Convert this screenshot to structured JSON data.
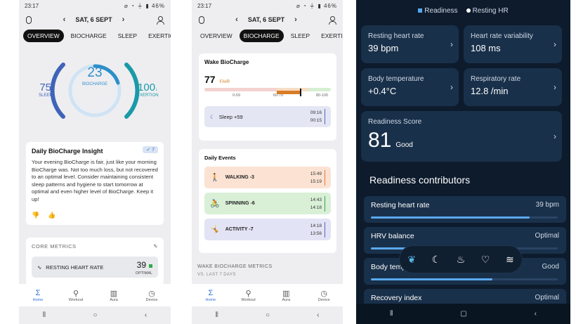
{
  "phone1": {
    "status": {
      "time": "23:17",
      "left_icons": "▣ ◎ ✉ •",
      "right": "⌀ ◔ ⏚ ▮ 46%"
    },
    "date": "SAT, 6 SEPT",
    "tabs": [
      "OVERVIEW",
      "BIOCHARGE",
      "SLEEP",
      "EXERTION"
    ],
    "gauge": {
      "center_value": "23",
      "center_label": "BIOCHARGE",
      "left_value": "75",
      "left_label": "SLEEP",
      "right_value": "100",
      "right_suffix": "↓",
      "right_label": "EXERTION"
    },
    "insight": {
      "title": "Daily BioCharge Insight",
      "badge": "✓ 7",
      "body": "Your evening BioCharge is fair, just like your morning BioCharge was. Not too much loss, but not recovered to an optimal level. Consider maintaining consistent sleep patterns and hygiene to start tomorrow at optimal and even higher level of BioCharge. Keep it up!"
    },
    "core": {
      "header": "CORE METRICS",
      "metric_label": "RESTING HEART RATE",
      "metric_value": "39",
      "metric_status": "OPTIMAL"
    }
  },
  "phone2": {
    "status": {
      "time": "23:17",
      "left_icons": "▣ ◎ ✉ •",
      "right": "⌀ ◔ ⏚ ▮ 46%"
    },
    "date": "SAT, 6 SEPT",
    "tabs": [
      "OVERVIEW",
      "BIOCHARGE",
      "SLEEP",
      "EXERTION"
    ],
    "wake": {
      "title": "Wake BioCharge",
      "score": "77",
      "score_label": "FAIR",
      "ticks": [
        "0-59",
        "60-79",
        "80-100"
      ],
      "sleep_label": "Sleep +59",
      "sleep_times": [
        "09:16",
        "00:15"
      ]
    },
    "events": {
      "title": "Daily Events",
      "items": [
        {
          "label": "WALKING -3",
          "times": [
            "15:49",
            "15:19"
          ]
        },
        {
          "label": "SPINNING -6",
          "times": [
            "14:43",
            "14:18"
          ]
        },
        {
          "label": "ACTIVITY -7",
          "times": [
            "14:18",
            "13:56"
          ]
        }
      ]
    },
    "wbm": {
      "title": "WAKE BIOCHARGE METRICS",
      "sub": "VS. LAST 7 DAYS"
    }
  },
  "bottom_nav": [
    "Home",
    "Workout",
    "Aura",
    "Device"
  ],
  "phone3": {
    "legend": [
      "Readiness",
      "Resting HR"
    ],
    "tiles": [
      {
        "title": "Resting heart rate",
        "value": "39 bpm"
      },
      {
        "title": "Heart rate variability",
        "value": "108 ms"
      },
      {
        "title": "Body temperature",
        "value": "+0.4°C"
      },
      {
        "title": "Respiratory rate",
        "value": "12.8 /min"
      }
    ],
    "readiness": {
      "title": "Readiness Score",
      "value": "81",
      "label": "Good"
    },
    "contributors_title": "Readiness contributors",
    "contributors": [
      {
        "label": "Resting heart rate",
        "value": "39 bpm",
        "fill": 0.85
      },
      {
        "label": "HRV balance",
        "value": "Optimal",
        "fill": 0.3
      },
      {
        "label": "Body temperature",
        "value": "Good",
        "fill": 0.65
      },
      {
        "label": "Recovery index",
        "value": "Optimal",
        "fill": 0.5
      }
    ]
  }
}
